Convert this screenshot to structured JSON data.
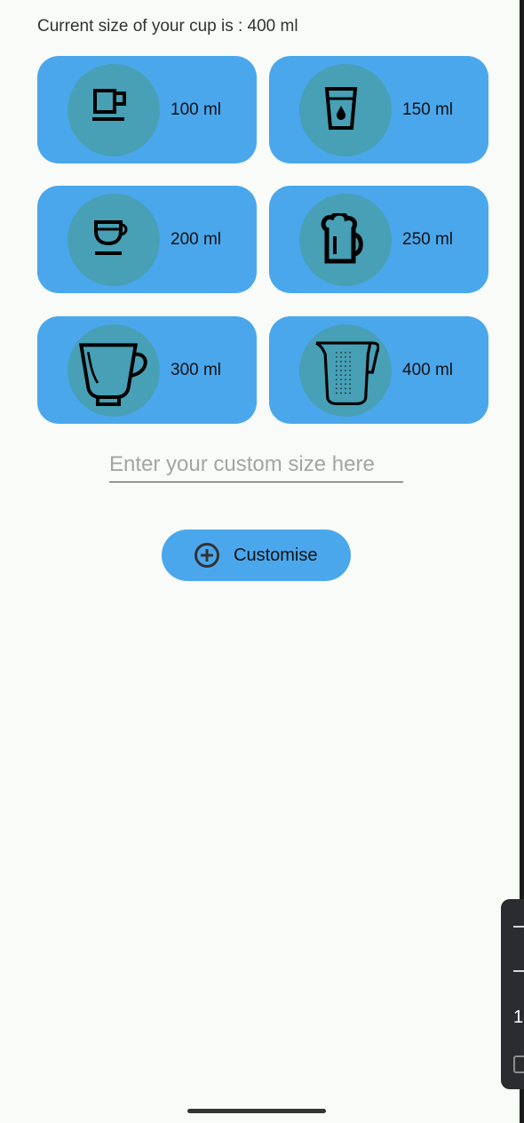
{
  "header": {
    "current_size_text": "Current size of your cup is : 400 ml"
  },
  "cups": [
    {
      "label": "100 ml",
      "icon": "espresso-cup-icon"
    },
    {
      "label": "150 ml",
      "icon": "water-glass-icon"
    },
    {
      "label": "200 ml",
      "icon": "coffee-cup-icon"
    },
    {
      "label": "250 ml",
      "icon": "beer-mug-icon"
    },
    {
      "label": "300 ml",
      "icon": "tea-cup-icon"
    },
    {
      "label": "400 ml",
      "icon": "measuring-jug-icon"
    }
  ],
  "custom": {
    "placeholder": "Enter your custom size here",
    "value": ""
  },
  "customise_button": {
    "label": "Customise",
    "icon": "plus-circle-icon"
  },
  "floating_panel": {
    "text": "1"
  },
  "colors": {
    "background": "#f8fbf7",
    "card": "#4ba7ec",
    "icon_circle": "#47a0b5",
    "text": "#333333"
  }
}
